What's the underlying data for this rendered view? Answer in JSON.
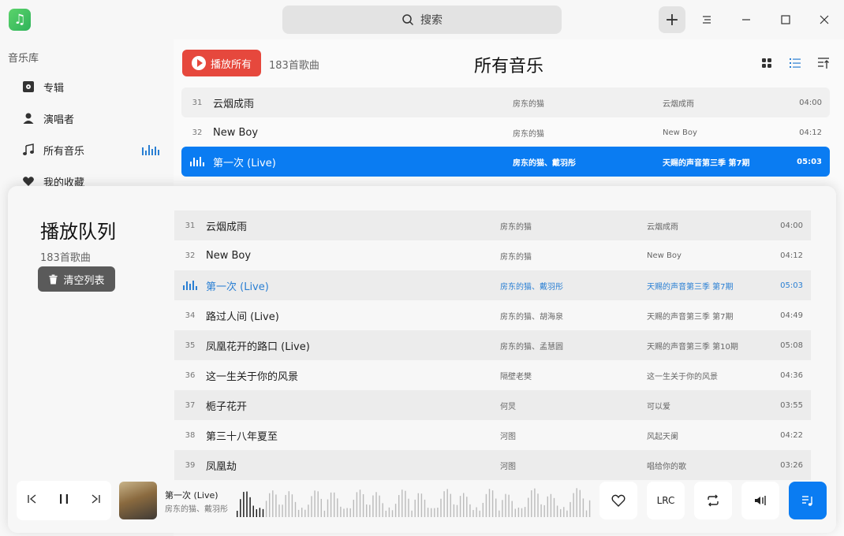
{
  "app": {
    "search_label": "搜索"
  },
  "sidebar": {
    "title": "音乐库",
    "items": [
      {
        "label": "专辑",
        "icon": "album-icon"
      },
      {
        "label": "演唱者",
        "icon": "singer-icon"
      },
      {
        "label": "所有音乐",
        "icon": "music-note-icon"
      },
      {
        "label": "我的收藏",
        "icon": "heart-icon"
      }
    ]
  },
  "main": {
    "play_all_label": "播放所有",
    "count": "183首歌曲",
    "title": "所有音乐",
    "rows": [
      {
        "num": "31",
        "title": "云烟成雨",
        "artist": "房东的猫",
        "album": "云烟成雨",
        "duration": "04:00"
      },
      {
        "num": "32",
        "title": "New Boy",
        "artist": "房东的猫",
        "album": "New Boy",
        "duration": "04:12"
      },
      {
        "num": "",
        "title": "第一次 (Live)",
        "artist": "房东的猫、戴羽彤",
        "album": "天赐的声音第三季 第7期",
        "duration": "05:03"
      }
    ]
  },
  "queue": {
    "title": "播放队列",
    "count": "183首歌曲",
    "clear_label": "清空列表",
    "rows": [
      {
        "num": "31",
        "title": "云烟成雨",
        "artist": "房东的猫",
        "album": "云烟成雨",
        "duration": "04:00"
      },
      {
        "num": "32",
        "title": "New Boy",
        "artist": "房东的猫",
        "album": "New Boy",
        "duration": "04:12"
      },
      {
        "num": "",
        "title": "第一次 (Live)",
        "artist": "房东的猫、戴羽彤",
        "album": "天赐的声音第三季 第7期",
        "duration": "05:03"
      },
      {
        "num": "34",
        "title": "路过人间 (Live)",
        "artist": "房东的猫、胡海泉",
        "album": "天赐的声音第三季 第7期",
        "duration": "04:49"
      },
      {
        "num": "35",
        "title": "凤凰花开的路口 (Live)",
        "artist": "房东的猫、孟慧圆",
        "album": "天赐的声音第三季 第10期",
        "duration": "05:08"
      },
      {
        "num": "36",
        "title": "这一生关于你的风景",
        "artist": "隔壁老樊",
        "album": "这一生关于你的风景",
        "duration": "04:36"
      },
      {
        "num": "37",
        "title": "栀子花开",
        "artist": "何炅",
        "album": "可以爱",
        "duration": "03:55"
      },
      {
        "num": "38",
        "title": "第三十八年夏至",
        "artist": "河图",
        "album": "风起天阑",
        "duration": "04:22"
      },
      {
        "num": "39",
        "title": "凤凰劫",
        "artist": "河图",
        "album": "唱给你的歌",
        "duration": "03:26"
      }
    ]
  },
  "player": {
    "title": "第一次 (Live)",
    "artist": "房东的猫、戴羽彤",
    "lrc_label": "LRC"
  },
  "colors": {
    "accent": "#0a7cf2",
    "play_all": "#e6483d"
  }
}
